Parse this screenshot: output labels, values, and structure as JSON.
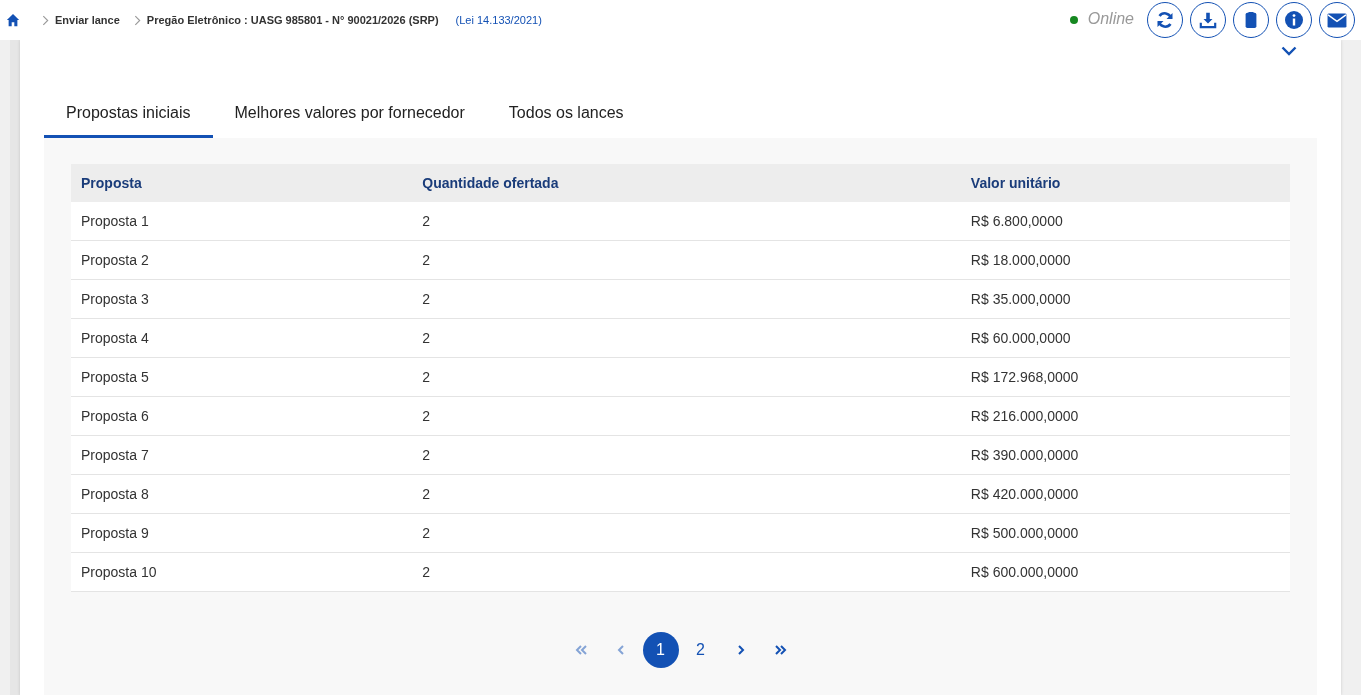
{
  "breadcrumb": {
    "items": [
      "Enviar lance",
      "Pregão Eletrônico : UASG 985801 - N° 90021/2026 (SRP)"
    ],
    "law": "(Lei 14.133/2021)"
  },
  "status": {
    "label": "Online",
    "online": true
  },
  "tabs": [
    {
      "label": "Propostas iniciais",
      "selected": true
    },
    {
      "label": "Melhores valores por fornecedor",
      "selected": false
    },
    {
      "label": "Todos os lances",
      "selected": false
    }
  ],
  "table": {
    "columns": [
      "Proposta",
      "Quantidade ofertada",
      "Valor unitário"
    ],
    "rows": [
      [
        "Proposta 1",
        "2",
        "R$ 6.800,0000"
      ],
      [
        "Proposta 2",
        "2",
        "R$ 18.000,0000"
      ],
      [
        "Proposta 3",
        "2",
        "R$ 35.000,0000"
      ],
      [
        "Proposta 4",
        "2",
        "R$ 60.000,0000"
      ],
      [
        "Proposta 5",
        "2",
        "R$ 172.968,0000"
      ],
      [
        "Proposta 6",
        "2",
        "R$ 216.000,0000"
      ],
      [
        "Proposta 7",
        "2",
        "R$ 390.000,0000"
      ],
      [
        "Proposta 8",
        "2",
        "R$ 420.000,0000"
      ],
      [
        "Proposta 9",
        "2",
        "R$ 500.000,0000"
      ],
      [
        "Proposta 10",
        "2",
        "R$ 600.000,0000"
      ]
    ]
  },
  "pagination": {
    "first_disabled": true,
    "prev_disabled": true,
    "pages": [
      {
        "label": "1",
        "selected": true
      },
      {
        "label": "2",
        "selected": false
      }
    ],
    "next_disabled": false,
    "last_disabled": false
  }
}
